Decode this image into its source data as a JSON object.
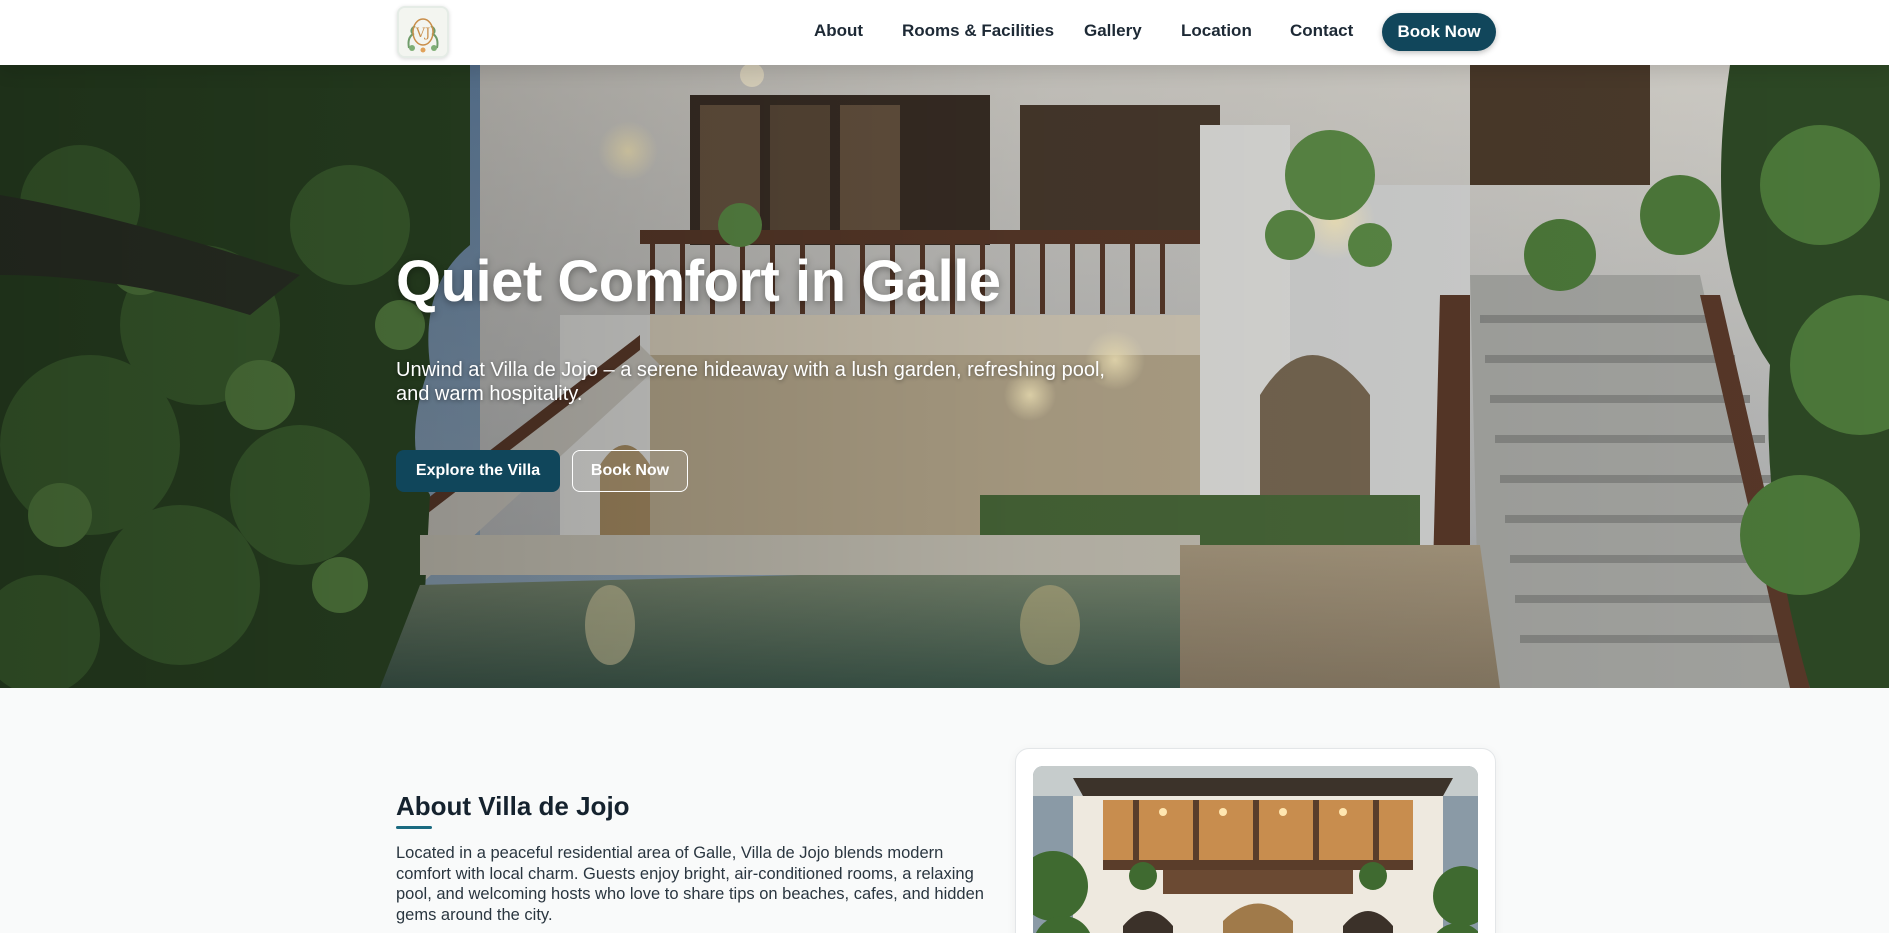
{
  "header": {
    "logo_alt": "Villa de Jojo logo",
    "nav": [
      {
        "label": "About"
      },
      {
        "label": "Rooms & Facilities"
      },
      {
        "label": "Gallery"
      },
      {
        "label": "Location"
      },
      {
        "label": "Contact"
      }
    ],
    "book_label": "Book Now"
  },
  "hero": {
    "title": "Quiet Comfort in Galle",
    "subtitle": "Unwind at Villa de Jojo – a serene hideaway with a lush garden, refreshing pool, and warm hospitality.",
    "primary_cta": "Explore the Villa",
    "secondary_cta": "Book Now",
    "image_alt": "Villa courtyard with pool and staircase at dusk"
  },
  "about": {
    "title": "About Villa de Jojo",
    "text": "Located in a peaceful residential area of Galle, Villa de Jojo blends modern comfort with local charm. Guests enjoy bright, air-conditioned rooms, a relaxing pool, and welcoming hosts who love to share tips on beaches, cafes, and hidden gems around the city.",
    "image_alt": "Front view of Villa de Jojo"
  },
  "colors": {
    "brand": "#11465b",
    "accent_underline": "#1a6a80",
    "page_bg": "#f9fafa",
    "text_dark": "#1d2935"
  }
}
